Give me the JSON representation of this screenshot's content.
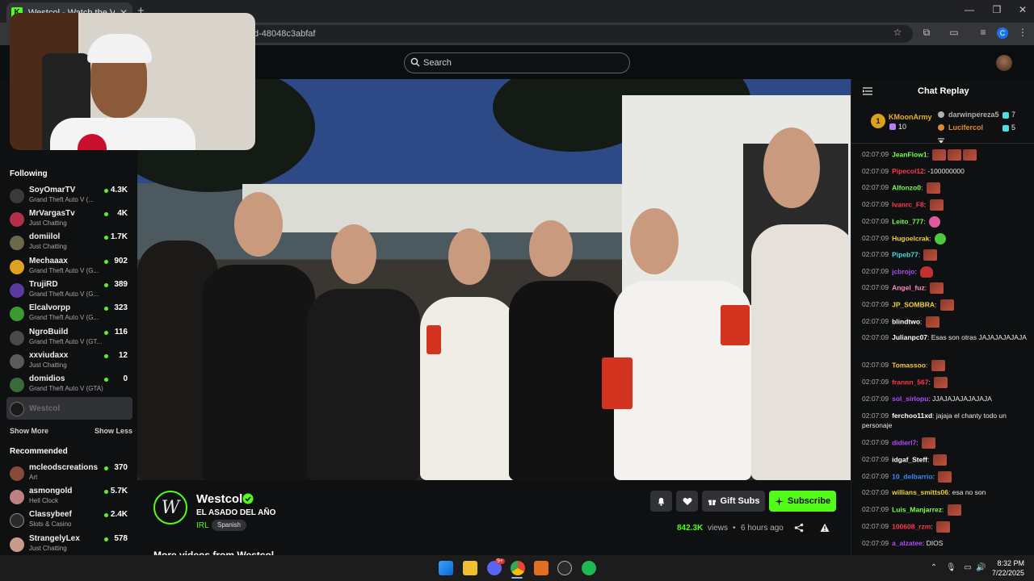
{
  "browser": {
    "tab_title": "Westcol - Watch the VOD",
    "url_fragment": "d-48048c3abfaf",
    "profile_initial": "C"
  },
  "header": {
    "search_placeholder": "Search"
  },
  "sidebar": {
    "following_title": "Following",
    "following": [
      {
        "name": "SoyOmarTV",
        "game": "Grand Theft Auto V (...",
        "viewers": "4.3K",
        "color": "#3a3a3a"
      },
      {
        "name": "MrVargasTv",
        "game": "Just Chatting",
        "viewers": "4K",
        "color": "#b0304a"
      },
      {
        "name": "domiilol",
        "game": "Just Chatting",
        "viewers": "1.7K",
        "color": "#6a6a4a"
      },
      {
        "name": "Mechaaax",
        "game": "Grand Theft Auto V (G...",
        "viewers": "902",
        "color": "#e0a020"
      },
      {
        "name": "TrujiRD",
        "game": "Grand Theft Auto V (G...",
        "viewers": "389",
        "color": "#5a3aa0"
      },
      {
        "name": "Elcalvorpp",
        "game": "Grand Theft Auto V (G...",
        "viewers": "323",
        "color": "#3a9a30"
      },
      {
        "name": "NgroBuild",
        "game": "Grand Theft Auto V (GT...",
        "viewers": "116",
        "color": "#4a4a4a"
      },
      {
        "name": "xxviudaxx",
        "game": "Just Chatting",
        "viewers": "12",
        "color": "#5a5a5a"
      },
      {
        "name": "domidios",
        "game": "Grand Theft Auto V (GTA)",
        "viewers": "0",
        "color": "#3a6a3a"
      }
    ],
    "current_channel": "Westcol",
    "show_more": "Show More",
    "show_less": "Show Less",
    "recommended_title": "Recommended",
    "recommended": [
      {
        "name": "mcleodscreations",
        "game": "Art",
        "viewers": "370",
        "color": "#8a4a3a"
      },
      {
        "name": "asmongold",
        "game": "Hell Clock",
        "viewers": "5.7K",
        "color": "#c08080"
      },
      {
        "name": "Classybeef",
        "game": "Slots & Casino",
        "viewers": "2.4K",
        "color": "#2a2a2a"
      },
      {
        "name": "StrangelyLex",
        "game": "Just Chatting",
        "viewers": "578",
        "color": "#c89a8a"
      }
    ]
  },
  "stream": {
    "streamer": "Westcol",
    "logo_letter": "W",
    "title": "EL ASADO DEL AÑO",
    "category": "IRL",
    "language": "Spanish",
    "gift_label": "Gift Subs",
    "subscribe_label": "Subscribe",
    "views": "842.3K",
    "views_suffix": "views",
    "separator": "•",
    "age": "6 hours ago",
    "more_videos": "More videos from Westcol"
  },
  "chat": {
    "title": "Chat Replay",
    "top_gifters": [
      {
        "rank": "1",
        "name": "KMoonArmy",
        "count": "10",
        "color": "#e8b020"
      },
      {
        "name": "darwinpereza5",
        "count": "7",
        "color": "#b0b0b0"
      },
      {
        "name": "Lucifercol",
        "count": "5",
        "color": "#e08a30"
      }
    ],
    "messages": [
      {
        "ts": "02:07:09",
        "user": "JeanFlow1",
        "color": "#7cff4a",
        "text": "",
        "emotes": 3,
        "etype": ""
      },
      {
        "ts": "02:07:09",
        "user": "Pipecol12",
        "color": "#ff3a4a",
        "text": "-100000000",
        "emotes": 0,
        "etype": ""
      },
      {
        "ts": "02:07:09",
        "user": "Alfonzo0",
        "color": "#7cff4a",
        "text": "",
        "emotes": 1,
        "etype": ""
      },
      {
        "ts": "02:07:09",
        "user": "Ivanrc_F8",
        "color": "#ff3a4a",
        "text": "",
        "emotes": 1,
        "etype": ""
      },
      {
        "ts": "02:07:09",
        "user": "Leito_777",
        "color": "#7cff4a",
        "text": "",
        "emotes": 1,
        "etype": "pink"
      },
      {
        "ts": "02:07:09",
        "user": "Hugoelcrak",
        "color": "#f0d040",
        "text": "",
        "emotes": 1,
        "etype": "green"
      },
      {
        "ts": "02:07:09",
        "user": "Pipeb77",
        "color": "#4adfe0",
        "text": "",
        "emotes": 1,
        "etype": ""
      },
      {
        "ts": "02:07:09",
        "user": "jcbrojo",
        "color": "#b04aff",
        "text": "",
        "emotes": 1,
        "etype": "red"
      },
      {
        "ts": "02:07:09",
        "user": "Angel_fuz",
        "color": "#ff8ac0",
        "text": "",
        "emotes": 1,
        "etype": ""
      },
      {
        "ts": "02:07:09",
        "user": "JP_SOMBRA",
        "color": "#f0d040",
        "text": "",
        "emotes": 1,
        "etype": ""
      },
      {
        "ts": "02:07:09",
        "user": "blindtwo",
        "color": "#ffffff",
        "text": "",
        "emotes": 1,
        "etype": ""
      },
      {
        "ts": "02:07:09",
        "user": "Julianpc07",
        "color": "#ffffff",
        "text": "Esas son otras JAJAJAJAJAJA",
        "emotes": 0,
        "etype": ""
      },
      {
        "ts": "02:07:09",
        "user": "Tomassoo",
        "color": "#f0d040",
        "text": "",
        "emotes": 1,
        "etype": ""
      },
      {
        "ts": "02:07:09",
        "user": "frannn_567",
        "color": "#ff3a4a",
        "text": "",
        "emotes": 1,
        "etype": ""
      },
      {
        "ts": "02:07:09",
        "user": "sol_sirlopu",
        "color": "#b04aff",
        "text": "JJAJAJAJAJAJAJA",
        "emotes": 0,
        "etype": ""
      },
      {
        "ts": "02:07:09",
        "user": "ferchoo11xd",
        "color": "#ffffff",
        "text": "jajaja el chanty todo un personaje",
        "emotes": 0,
        "etype": ""
      },
      {
        "ts": "02:07:09",
        "user": "didierl7",
        "color": "#b04aff",
        "text": "",
        "emotes": 1,
        "etype": ""
      },
      {
        "ts": "02:07:09",
        "user": "idgaf_Steff",
        "color": "#ffffff",
        "text": "",
        "emotes": 1,
        "etype": ""
      },
      {
        "ts": "02:07:09",
        "user": "10_delbarrio",
        "color": "#3a8aff",
        "text": "",
        "emotes": 1,
        "etype": ""
      },
      {
        "ts": "02:07:09",
        "user": "willians_smitts06",
        "color": "#f0d040",
        "text": "esa no son",
        "emotes": 0,
        "etype": ""
      },
      {
        "ts": "02:07:09",
        "user": "Luis_Manjarrez",
        "color": "#7cff4a",
        "text": "",
        "emotes": 1,
        "etype": ""
      },
      {
        "ts": "02:07:09",
        "user": "100608_rzm",
        "color": "#ff3a4a",
        "text": "",
        "emotes": 1,
        "etype": ""
      },
      {
        "ts": "02:07:09",
        "user": "a_alzatee",
        "color": "#b04aff",
        "text": "DIOS",
        "emotes": 0,
        "etype": ""
      }
    ]
  },
  "taskbar": {
    "time": "8:32 PM",
    "date": "7/22/2025",
    "discord_badge": "9+"
  },
  "colors": {
    "accent": "#53fc18",
    "background": "#0f1011",
    "button": "#303236"
  }
}
